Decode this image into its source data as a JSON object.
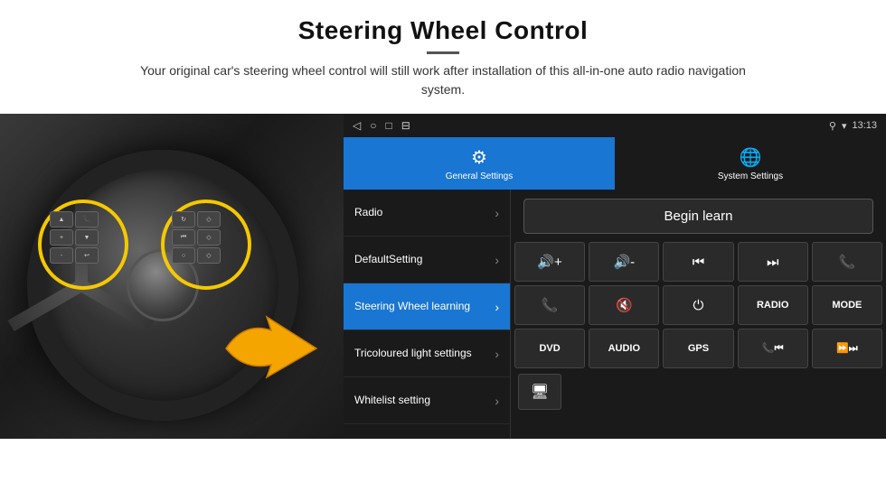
{
  "header": {
    "title": "Steering Wheel Control",
    "divider": true,
    "description": "Your original car's steering wheel control will still work after installation of this all-in-one auto radio navigation system."
  },
  "status_bar": {
    "time": "13:13",
    "icons": [
      "◁",
      "○",
      "□",
      "⊟"
    ]
  },
  "tabs": [
    {
      "id": "general",
      "label": "General Settings",
      "icon": "⚙",
      "active": true
    },
    {
      "id": "system",
      "label": "System Settings",
      "icon": "🌐",
      "active": false
    }
  ],
  "menu_items": [
    {
      "id": "radio",
      "label": "Radio",
      "active": false
    },
    {
      "id": "defaultsetting",
      "label": "DefaultSetting",
      "active": false
    },
    {
      "id": "swlearning",
      "label": "Steering Wheel learning",
      "active": true
    },
    {
      "id": "tricoloured",
      "label": "Tricoloured light settings",
      "active": false
    },
    {
      "id": "whitelist",
      "label": "Whitelist setting",
      "active": false
    }
  ],
  "controls": {
    "begin_learn": "Begin learn",
    "row1": [
      "🔊+",
      "🔊-",
      "⏮",
      "⏭",
      "📞"
    ],
    "row2": [
      "📞",
      "🔇",
      "⏻",
      "RADIO",
      "MODE"
    ],
    "row3": [
      "DVD",
      "AUDIO",
      "GPS",
      "📞⏮",
      "⏩⏭"
    ],
    "icon_row": [
      "🖥"
    ]
  }
}
